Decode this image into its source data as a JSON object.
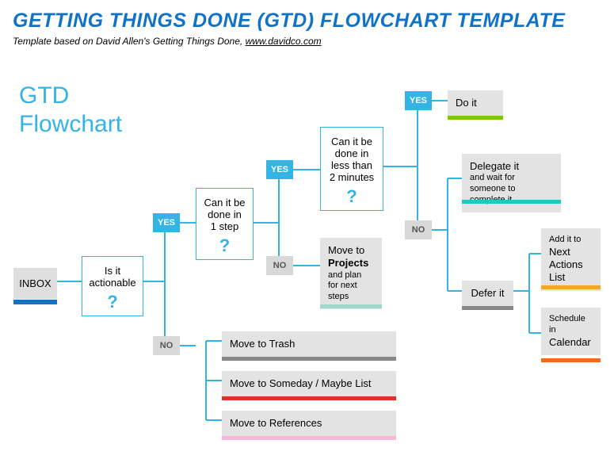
{
  "header": {
    "title": "GETTING THINGS DONE (GTD) FLOWCHART TEMPLATE",
    "subtitle_prefix": "Template based on David Allen's Getting Things Done,  ",
    "subtitle_link": "www.davidco.com"
  },
  "chart_title_l1": "GTD",
  "chart_title_l2": "Flowchart",
  "inbox": "INBOX",
  "q1": "Is it actionable",
  "q2_l1": "Can it be",
  "q2_l2": "done in",
  "q2_l3": "1 step",
  "q3_l1": "Can it be",
  "q3_l2": "done in",
  "q3_l3": "less than",
  "q3_l4": "2 minutes",
  "yes": "YES",
  "no": "NO",
  "trash": "Move to Trash",
  "someday": "Move to Someday / Maybe List",
  "refs": "Move to References",
  "projects_l1": "Move to",
  "projects_l2": "Projects",
  "projects_l3": "and plan for next steps",
  "doit": "Do it",
  "delegate_l1": "Delegate it",
  "delegate_l2": "and wait for someone to complete it",
  "defer": "Defer it",
  "nextact_l1": "Add it to",
  "nextact_l2": "Next Actions List",
  "cal_l1": "Schedule in",
  "cal_l2": "Calendar",
  "chart_data": {
    "type": "flowchart",
    "start": "INBOX",
    "nodes": [
      {
        "id": "inbox",
        "label": "INBOX",
        "type": "start"
      },
      {
        "id": "actionable",
        "label": "Is it actionable?",
        "type": "decision"
      },
      {
        "id": "trash",
        "label": "Move to Trash",
        "type": "terminal"
      },
      {
        "id": "someday",
        "label": "Move to Someday / Maybe List",
        "type": "terminal"
      },
      {
        "id": "references",
        "label": "Move to References",
        "type": "terminal"
      },
      {
        "id": "onestep",
        "label": "Can it be done in 1 step?",
        "type": "decision"
      },
      {
        "id": "projects",
        "label": "Move to Projects and plan for next steps",
        "type": "terminal"
      },
      {
        "id": "twomin",
        "label": "Can it be done in less than 2 minutes?",
        "type": "decision"
      },
      {
        "id": "doit",
        "label": "Do it",
        "type": "terminal"
      },
      {
        "id": "delegate",
        "label": "Delegate it and wait for someone to complete it",
        "type": "terminal"
      },
      {
        "id": "defer",
        "label": "Defer it",
        "type": "action"
      },
      {
        "id": "nextactions",
        "label": "Add it to Next Actions List",
        "type": "terminal"
      },
      {
        "id": "calendar",
        "label": "Schedule in Calendar",
        "type": "terminal"
      }
    ],
    "edges": [
      {
        "from": "inbox",
        "to": "actionable"
      },
      {
        "from": "actionable",
        "to": "onestep",
        "label": "YES"
      },
      {
        "from": "actionable",
        "to": "trash",
        "label": "NO"
      },
      {
        "from": "actionable",
        "to": "someday",
        "label": "NO"
      },
      {
        "from": "actionable",
        "to": "references",
        "label": "NO"
      },
      {
        "from": "onestep",
        "to": "twomin",
        "label": "YES"
      },
      {
        "from": "onestep",
        "to": "projects",
        "label": "NO"
      },
      {
        "from": "twomin",
        "to": "doit",
        "label": "YES"
      },
      {
        "from": "twomin",
        "to": "delegate",
        "label": "NO"
      },
      {
        "from": "twomin",
        "to": "defer",
        "label": "NO"
      },
      {
        "from": "defer",
        "to": "nextactions"
      },
      {
        "from": "defer",
        "to": "calendar"
      }
    ]
  }
}
